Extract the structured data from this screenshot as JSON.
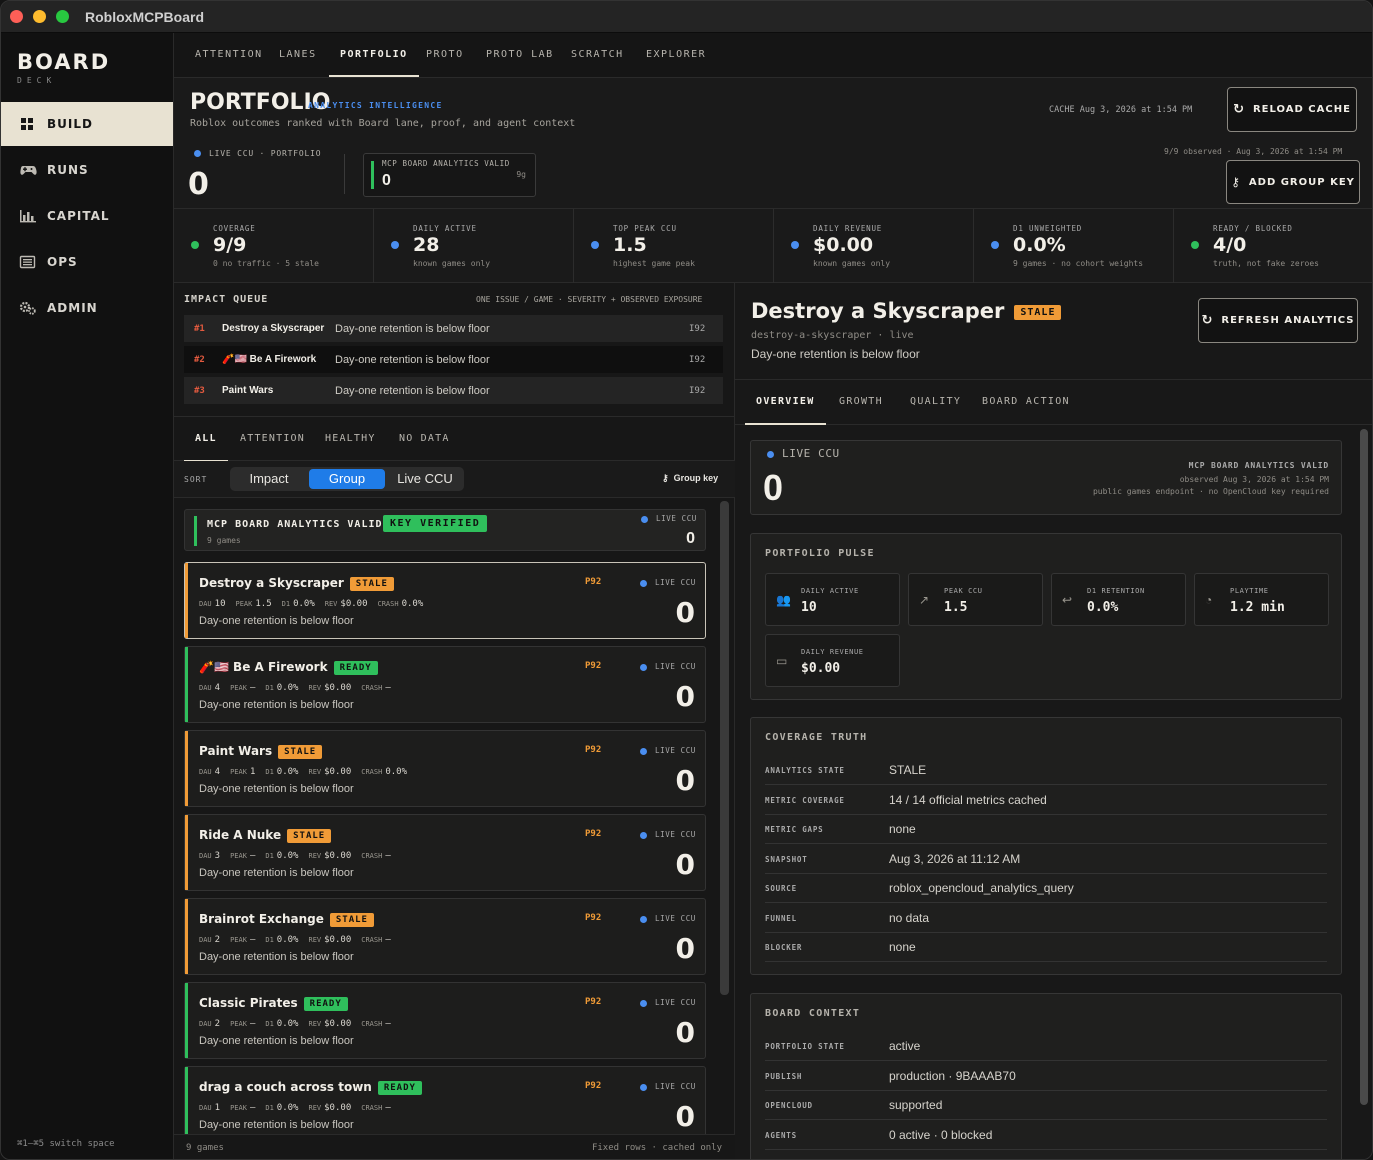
{
  "window": {
    "title": "RobloxMCPBoard"
  },
  "sidebar": {
    "brand": "BOARD",
    "brand_sub": "DECK",
    "items": [
      {
        "label": "BUILD",
        "icon": "grid-icon"
      },
      {
        "label": "RUNS",
        "icon": "gamepad-icon"
      },
      {
        "label": "CAPITAL",
        "icon": "bar-chart-icon"
      },
      {
        "label": "OPS",
        "icon": "list-icon"
      },
      {
        "label": "ADMIN",
        "icon": "gears-icon"
      }
    ],
    "footer": "⌘1–⌘5 switch space"
  },
  "tabs": [
    "ATTENTION",
    "LANES",
    "PORTFOLIO",
    "PROTO",
    "PROTO LAB",
    "SCRATCH",
    "EXPLORER"
  ],
  "header": {
    "title": "PORTFOLIO",
    "badge": "ANALYTICS INTELLIGENCE",
    "subtitle": "Roblox outcomes ranked with Board lane, proof, and agent context",
    "cache": "CACHE Aug 3, 2026 at 1:54 PM",
    "reload_label": "RELOAD CACHE",
    "live_label": "LIVE CCU · PORTFOLIO",
    "live_value": "0",
    "mcp_label": "MCP BOARD ANALYTICS VALID",
    "mcp_value": "0",
    "mcp_count": "9g",
    "observed": "9/9 observed · Aug 3, 2026 at 1:54 PM",
    "add_key_label": "ADD GROUP KEY"
  },
  "stats": [
    {
      "label": "COVERAGE",
      "value": "9/9",
      "sub": "0 no traffic · 5 stale",
      "color": "#2fbf5c"
    },
    {
      "label": "DAILY ACTIVE",
      "value": "28",
      "sub": "known games only",
      "color": "#4a8ef0"
    },
    {
      "label": "TOP PEAK CCU",
      "value": "1.5",
      "sub": "highest game peak",
      "color": "#4a8ef0"
    },
    {
      "label": "DAILY REVENUE",
      "value": "$0.00",
      "sub": "known games only",
      "color": "#4a8ef0"
    },
    {
      "label": "D1 UNWEIGHTED",
      "value": "0.0%",
      "sub": "9 games · no cohort weights",
      "color": "#4a8ef0"
    },
    {
      "label": "READY / BLOCKED",
      "value": "4/0",
      "sub": "truth, not fake zeroes",
      "color": "#2fbf5c"
    }
  ],
  "impact_queue": {
    "title": "IMPACT QUEUE",
    "meta": "ONE ISSUE / GAME · SEVERITY + OBSERVED EXPOSURE",
    "rows": [
      {
        "rank": "#1",
        "name": "Destroy a Skyscraper",
        "desc": "Day-one retention is below floor",
        "score": "I92"
      },
      {
        "rank": "#2",
        "name": "🧨🇺🇸 Be A Firework",
        "desc": "Day-one retention is below floor",
        "score": "I92"
      },
      {
        "rank": "#3",
        "name": "Paint Wars",
        "desc": "Day-one retention is below floor",
        "score": "I92"
      }
    ]
  },
  "filter_tabs": [
    "ALL",
    "ATTENTION",
    "HEALTHY",
    "NO DATA"
  ],
  "sort": {
    "label": "SORT",
    "options": [
      "Impact",
      "Group",
      "Live CCU"
    ],
    "selected": "Group",
    "group_key": "Group key"
  },
  "group_card": {
    "title": "MCP BOARD ANALYTICS VALID",
    "badge": "KEY VERIFIED",
    "sub": "9 games",
    "live_label": "LIVE CCU",
    "live_value": "0"
  },
  "games": [
    {
      "name": "Destroy a Skyscraper",
      "status": "STALE",
      "dau": "10",
      "peak": "1.5",
      "d1": "0.0%",
      "rev": "$0.00",
      "crash": "0.0%",
      "desc": "Day-one retention is below floor",
      "pri": "P92",
      "live_label": "LIVE CCU",
      "live": "0"
    },
    {
      "name": "🧨🇺🇸 Be A Firework",
      "status": "READY",
      "dau": "4",
      "peak": "—",
      "d1": "0.0%",
      "rev": "$0.00",
      "crash": "—",
      "desc": "Day-one retention is below floor",
      "pri": "P92",
      "live_label": "LIVE CCU",
      "live": "0"
    },
    {
      "name": "Paint Wars",
      "status": "STALE",
      "dau": "4",
      "peak": "1",
      "d1": "0.0%",
      "rev": "$0.00",
      "crash": "0.0%",
      "desc": "Day-one retention is below floor",
      "pri": "P92",
      "live_label": "LIVE CCU",
      "live": "0"
    },
    {
      "name": "Ride A Nuke",
      "status": "STALE",
      "dau": "3",
      "peak": "—",
      "d1": "0.0%",
      "rev": "$0.00",
      "crash": "—",
      "desc": "Day-one retention is below floor",
      "pri": "P92",
      "live_label": "LIVE CCU",
      "live": "0"
    },
    {
      "name": "Brainrot Exchange",
      "status": "STALE",
      "dau": "2",
      "peak": "—",
      "d1": "0.0%",
      "rev": "$0.00",
      "crash": "—",
      "desc": "Day-one retention is below floor",
      "pri": "P92",
      "live_label": "LIVE CCU",
      "live": "0"
    },
    {
      "name": "Classic Pirates",
      "status": "READY",
      "dau": "2",
      "peak": "—",
      "d1": "0.0%",
      "rev": "$0.00",
      "crash": "—",
      "desc": "Day-one retention is below floor",
      "pri": "P92",
      "live_label": "LIVE CCU",
      "live": "0"
    },
    {
      "name": "drag a couch across town",
      "status": "READY",
      "dau": "1",
      "peak": "—",
      "d1": "0.0%",
      "rev": "$0.00",
      "crash": "—",
      "desc": "Day-one retention is below floor",
      "pri": "P92",
      "live_label": "LIVE CCU",
      "live": "0"
    }
  ],
  "metric_keys": {
    "dau": "DAU",
    "peak": "PEAK",
    "d1": "D1",
    "rev": "REV",
    "crash": "CRASH"
  },
  "list_footer": {
    "left": "9 games",
    "right": "Fixed rows · cached only"
  },
  "detail": {
    "title": "Destroy a Skyscraper",
    "status": "STALE",
    "slug": "destroy-a-skyscraper · live",
    "desc": "Day-one retention is below floor",
    "refresh_label": "REFRESH ANALYTICS",
    "tabs": [
      "OVERVIEW",
      "GROWTH",
      "QUALITY",
      "BOARD ACTION"
    ],
    "live": {
      "label": "LIVE CCU",
      "value": "0",
      "valid": "MCP BOARD ANALYTICS VALID",
      "observed": "observed Aug 3, 2026 at 1:54 PM",
      "endpoint": "public games endpoint · no OpenCloud key required"
    },
    "pulse": {
      "title": "PORTFOLIO PULSE",
      "tiles": [
        {
          "label": "DAILY ACTIVE",
          "value": "10",
          "icon": "users-icon"
        },
        {
          "label": "PEAK CCU",
          "value": "1.5",
          "icon": "arrow-up-right-icon"
        },
        {
          "label": "D1 RETENTION",
          "value": "0.0%",
          "icon": "return-arrow-icon"
        },
        {
          "label": "PLAYTIME",
          "value": "1.2 min",
          "icon": "clock-icon"
        },
        {
          "label": "DAILY REVENUE",
          "value": "$0.00",
          "icon": "banknote-icon"
        }
      ]
    },
    "coverage": {
      "title": "COVERAGE TRUTH",
      "rows": [
        {
          "k": "ANALYTICS STATE",
          "v": "STALE"
        },
        {
          "k": "METRIC COVERAGE",
          "v": "14 / 14 official metrics cached"
        },
        {
          "k": "METRIC GAPS",
          "v": "none"
        },
        {
          "k": "SNAPSHOT",
          "v": "Aug 3, 2026 at 11:12 AM"
        },
        {
          "k": "SOURCE",
          "v": "roblox_opencloud_analytics_query"
        },
        {
          "k": "FUNNEL",
          "v": "no data"
        },
        {
          "k": "BLOCKER",
          "v": "none"
        }
      ]
    },
    "context": {
      "title": "BOARD CONTEXT",
      "rows": [
        {
          "k": "PORTFOLIO STATE",
          "v": "active"
        },
        {
          "k": "PUBLISH",
          "v": "production · 9BAAAB70"
        },
        {
          "k": "OPENCLOUD",
          "v": "supported"
        },
        {
          "k": "AGENTS",
          "v": "0 active · 0 blocked"
        }
      ]
    }
  },
  "colors": {
    "accent_blue": "#4a8ef0",
    "ready_green": "#2fbf5c",
    "stale_orange": "#f09b37",
    "sidebar_active": "#e8e2d2"
  }
}
